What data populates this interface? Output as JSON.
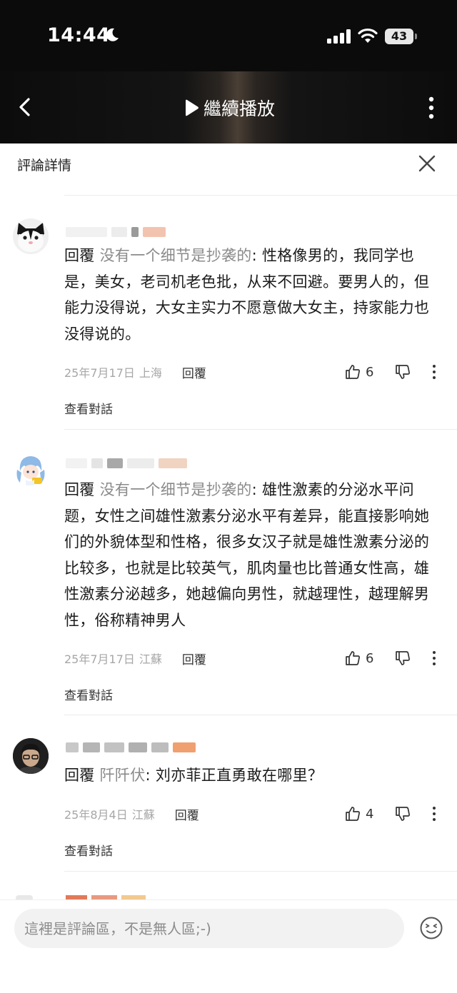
{
  "status_bar": {
    "time": "14:44",
    "battery": "43"
  },
  "header": {
    "continue_label": "繼續播放"
  },
  "panel": {
    "title": "評論詳情"
  },
  "comments": [
    {
      "reply_word": "回覆",
      "reply_to": "没有一个细节是抄袭的",
      "text": ": 性格像男的，我同学也是，美女，老司机老色批，从来不回避。要男人的，但能力没得说，大女主实力不愿意做大女主，持家能力也没得说的。",
      "date": "25年7月17日",
      "location": "上海",
      "reply_label": "回覆",
      "likes": "6",
      "view_conversation": "查看對話"
    },
    {
      "reply_word": "回覆",
      "reply_to": "没有一个细节是抄袭的",
      "text": ": 雄性激素的分泌水平问题，女性之间雄性激素分泌水平有差异，能直接影响她们的外貌体型和性格，很多女汉子就是雄性激素分泌的比较多，也就是比较英气，肌肉量也比普通女性高，雄性激素分泌越多，她越偏向男性，就越理性，越理解男性，俗称精神男人",
      "date": "25年7月17日",
      "location": "江蘇",
      "reply_label": "回覆",
      "likes": "6",
      "view_conversation": "查看對話"
    },
    {
      "reply_word": "回覆",
      "reply_to": "阡阡伏",
      "text": ": 刘亦菲正直勇敢在哪里？",
      "date": "25年8月4日",
      "location": "江蘇",
      "reply_label": "回覆",
      "likes": "4",
      "view_conversation": "查看對話"
    }
  ],
  "input": {
    "placeholder": "這裡是評論區，不是無人區;-)"
  },
  "icons": {
    "status": [
      "moon-icon",
      "signal-icon",
      "wifi-icon",
      "battery-icon"
    ],
    "header": [
      "back-icon",
      "play-icon",
      "more-vertical-icon"
    ],
    "panel": [
      "close-icon"
    ],
    "comment": [
      "thumbs-up-icon",
      "thumbs-down-icon",
      "more-vertical-icon"
    ],
    "input": [
      "emoji-icon"
    ]
  }
}
